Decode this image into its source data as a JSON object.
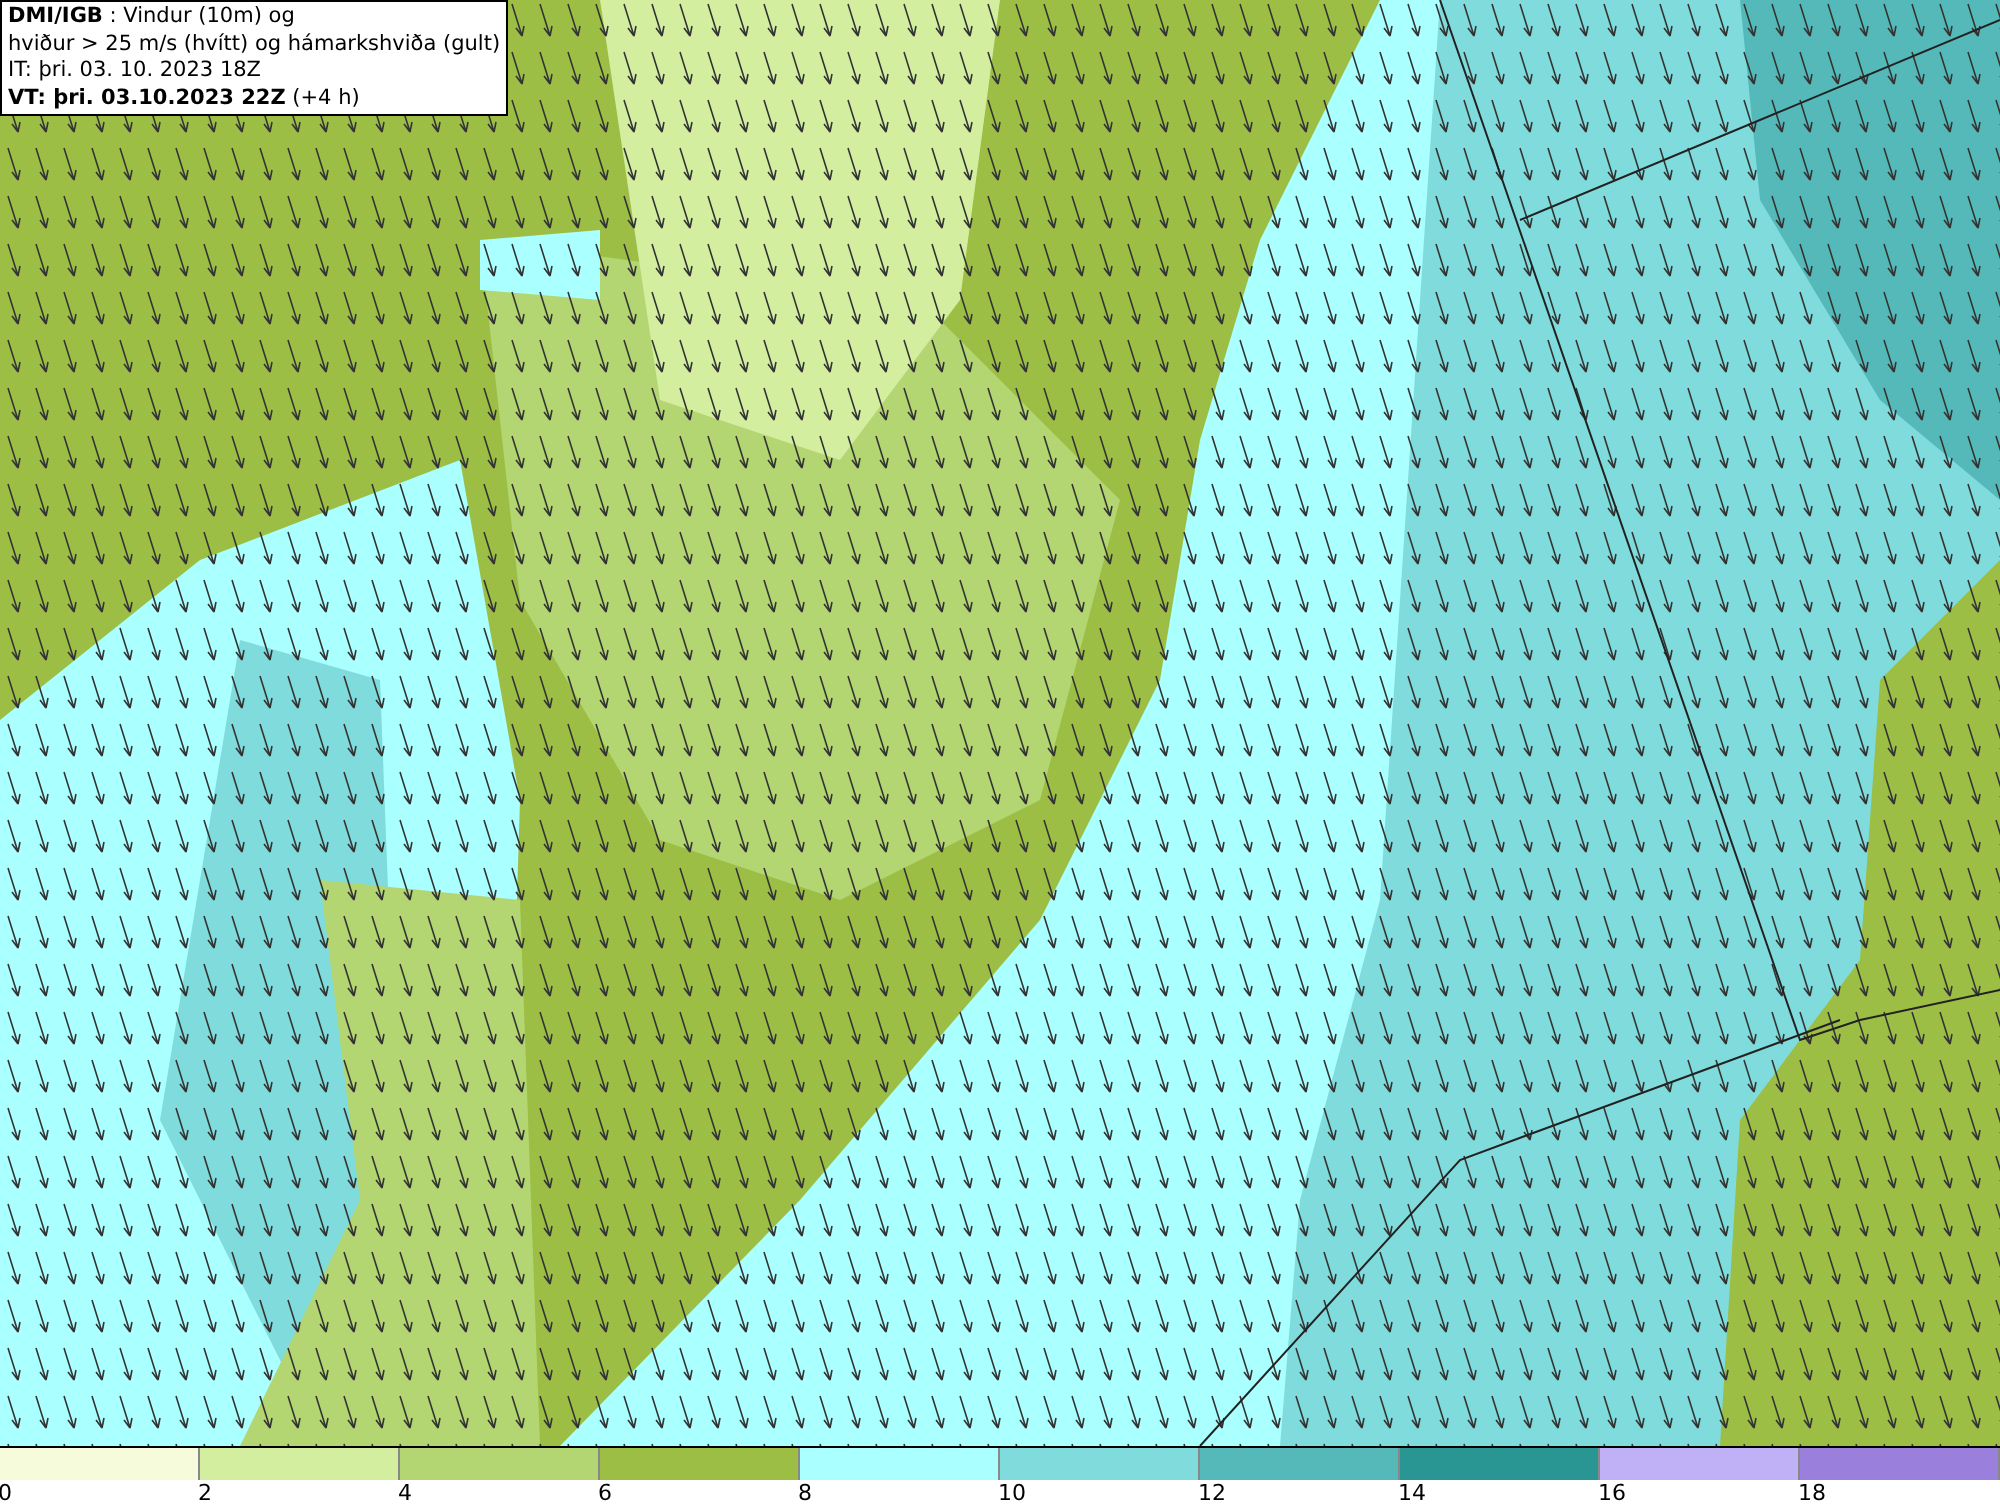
{
  "info_box": {
    "lines": [
      "**DMI/IGB** : Vindur (10m) og",
      "hviður > 25 m/s (hvítt) og hámarkshviða (gult)",
      "IT: þri. 03. 10. 2023 18Z",
      "**VT: þri. 03.10.2023 22Z** (+4 h)"
    ]
  },
  "legend": {
    "bins": [
      {
        "color": "#f6fbdc"
      },
      {
        "color": "#d4eea0"
      },
      {
        "color": "#b3d672"
      },
      {
        "color": "#9cbe44"
      },
      {
        "color": "#aaffff"
      },
      {
        "color": "#80dcdc"
      },
      {
        "color": "#55b9b9"
      },
      {
        "color": "#2a9693"
      },
      {
        "color": "#c0b0f5"
      },
      {
        "color": "#9b7fdc"
      }
    ],
    "labels": [
      "0",
      "2",
      "4",
      "6",
      "8",
      "10",
      "12",
      "14",
      "16",
      "18"
    ]
  }
}
